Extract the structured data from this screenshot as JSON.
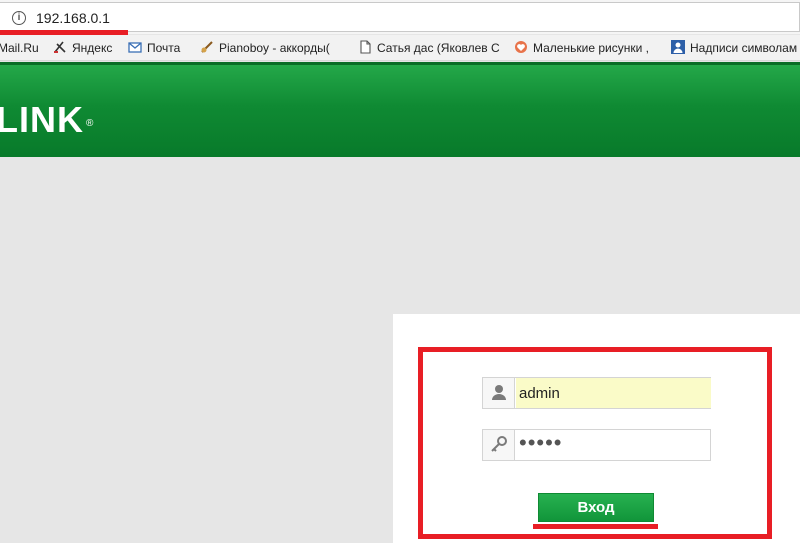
{
  "address_bar": {
    "url": "192.168.0.1",
    "info_icon": "info-icon",
    "info_glyph": "i"
  },
  "bookmarks": [
    {
      "label": "Mail.Ru",
      "icon": "mailru-icon"
    },
    {
      "label": "Яндекс",
      "icon": "yandex-icon"
    },
    {
      "label": "Почта",
      "icon": "mail-icon"
    },
    {
      "label": "Pianoboy - аккорды(",
      "icon": "guitar-icon"
    },
    {
      "label": "Сатья дас (Яковлев С",
      "icon": "page-icon"
    },
    {
      "label": "Маленькие рисунки ,",
      "icon": "heart-icon"
    },
    {
      "label": "Надписи символам",
      "icon": "person-icon"
    }
  ],
  "header": {
    "logo_text": "LINK",
    "logo_mark": "®",
    "color": "#0f8a33"
  },
  "login": {
    "username_value": "admin",
    "password_value": "•••••",
    "submit_label": "Вход"
  },
  "colors": {
    "accent_green": "#11953a",
    "highlight_red": "#e81e25",
    "autofill_yellow": "#fafbc8"
  }
}
